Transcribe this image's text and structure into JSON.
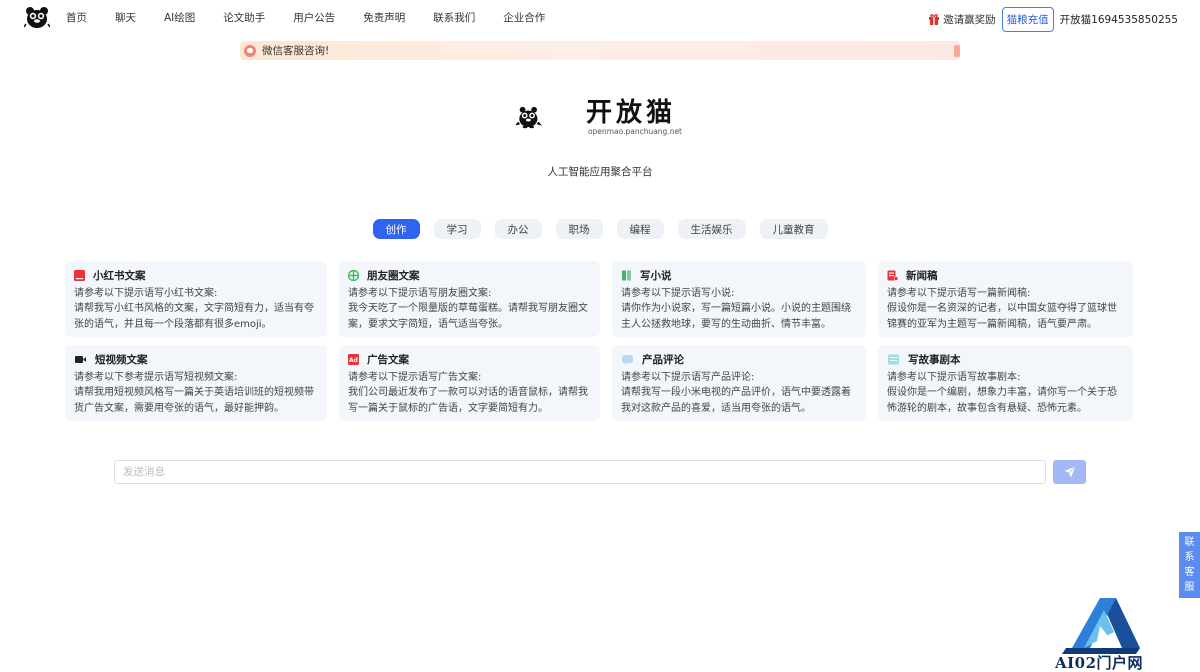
{
  "nav": {
    "logo_icon": "panda-cat-logo-icon",
    "items": [
      "首页",
      "聊天",
      "AI绘图",
      "论文助手",
      "用户公告",
      "免责声明",
      "联系我们",
      "企业合作"
    ],
    "invite_label": "邀请赢奖励",
    "invite_icon": "gift-icon",
    "recharge_label": "猫粮充值",
    "username": "开放猫1694535850255"
  },
  "banner": {
    "icon": "bell-icon",
    "text": "微信客服咨询!"
  },
  "hero": {
    "brand": "开放猫",
    "domain": "openmao.panchuang.net",
    "subtitle": "人工智能应用聚合平台"
  },
  "tabs": [
    "创作",
    "学习",
    "办公",
    "职场",
    "编程",
    "生活娱乐",
    "儿童教育"
  ],
  "active_tab": "创作",
  "cards": [
    {
      "title": "小红书文案",
      "icon": "xiaohongshu-icon",
      "prompt": "请参考以下提示语写小红书文案:",
      "desc": "请帮我写小红书风格的文案，文字简短有力，适当有夸张的语气，并且每一个段落都有很多emoji。"
    },
    {
      "title": "朋友圈文案",
      "icon": "moments-icon",
      "prompt": "请参考以下提示语写朋友圈文案:",
      "desc": "我今天吃了一个限量版的草莓蛋糕。请帮我写朋友圈文案，要求文字简短，语气适当夸张。"
    },
    {
      "title": "写小说",
      "icon": "book-icon",
      "prompt": "请参考以下提示语写小说:",
      "desc": "请你作为小说家，写一篇短篇小说。小说的主题围绕主人公拯救地球，要写的生动曲折、情节丰富。"
    },
    {
      "title": "新闻稿",
      "icon": "news-icon",
      "prompt": "请参考以下提示语写一篇新闻稿:",
      "desc": "假设你是一名资深的记者，以中国女篮夺得了篮球世锦赛的亚军为主题写一篇新闻稿，语气要严肃。"
    },
    {
      "title": "短视频文案",
      "icon": "video-camera-icon",
      "prompt": "请参考以下参考提示语写短视频文案:",
      "desc": "请帮我用短视频风格写一篇关于英语培训班的短视频带货广告文案，需要用夸张的语气，最好能押韵。"
    },
    {
      "title": "广告文案",
      "icon": "ad-icon",
      "prompt": "请参考以下提示语写广告文案:",
      "desc": "我们公司最近发布了一款可以对话的语音鼠标，请帮我写一篇关于鼠标的广告语，文字要简短有力。"
    },
    {
      "title": "产品评论",
      "icon": "comment-icon",
      "prompt": "请参考以下提示语写产品评论:",
      "desc": "请帮我写一段小米电视的产品评价，语气中要透露着我对这款产品的喜爱，适当用夸张的语气。"
    },
    {
      "title": "写故事剧本",
      "icon": "script-icon",
      "prompt": "请参考以下提示语写故事剧本:",
      "desc": "假设你是一个编剧，想象力丰富，请你写一个关于恐怖游轮的剧本，故事包含有悬疑、恐怖元素。"
    }
  ],
  "input": {
    "placeholder": "发送消息",
    "value": "",
    "send_icon": "send-icon"
  },
  "service_tab": [
    "联",
    "系",
    "客",
    "服"
  ],
  "watermark": {
    "icon": "ai02-logo-icon",
    "text": "AI02门户网"
  },
  "colors": {
    "accent": "#2f63f1",
    "card_bg": "#f3f6fb",
    "tab_bg": "#eef1f6",
    "send_button": "#a3b8f4",
    "service_tab": "#5b8def"
  }
}
